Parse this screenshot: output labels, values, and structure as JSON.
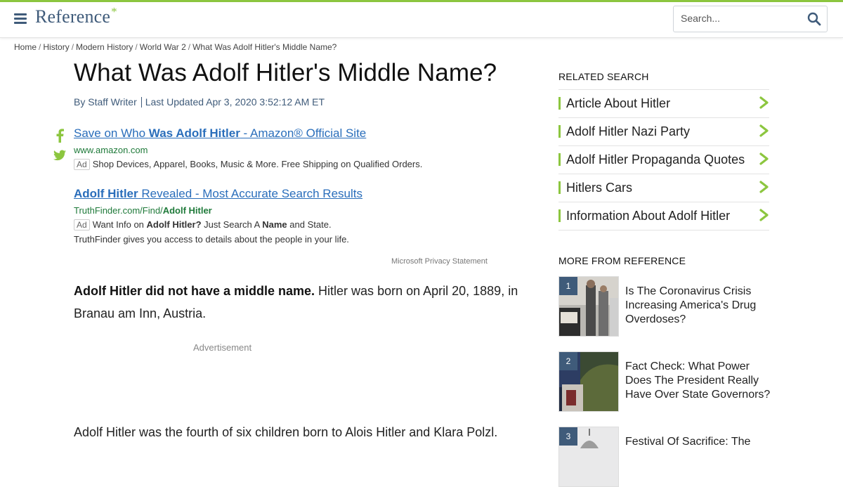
{
  "brand": {
    "name": "Reference",
    "star": "*",
    "accent": "#8cc63f",
    "primary": "#3f5b7a"
  },
  "search": {
    "placeholder": "Search..."
  },
  "breadcrumb": [
    "Home",
    "History",
    "Modern History",
    "World War 2",
    "What Was Adolf Hitler's Middle Name?"
  ],
  "article": {
    "title": "What Was Adolf Hitler's Middle Name?",
    "author": "By Staff Writer",
    "updated": "Last Updated Apr 3, 2020 3:52:12 AM ET",
    "lead_bold": "Adolf Hitler did not have a middle name.",
    "lead_rest": " Hitler was born on April 20, 1889, in Branau am Inn, Austria.",
    "advertisement_label": "Advertisement",
    "paragraph2": "Adolf Hitler was the fourth of six children born to Alois Hitler and Klara Polzl."
  },
  "share": {
    "icons": [
      "facebook-icon",
      "twitter-icon"
    ]
  },
  "ads": [
    {
      "title_pre": "Save on Who ",
      "title_bold": "Was Adolf Hitler",
      "title_post": " - Amazon® Official Site",
      "url_pre": "www.amazon.com",
      "url_bold": "",
      "badge": "Ad",
      "desc": "Shop Devices, Apparel, Books, Music & More. Free Shipping on Qualified Orders."
    },
    {
      "title_pre": "",
      "title_bold": "Adolf Hitler",
      "title_post": " Revealed - Most Accurate Search Results",
      "url_pre": "TruthFinder.com/Find/",
      "url_bold": "Adolf Hitler",
      "badge": "Ad",
      "desc_1": "Want Info on ",
      "desc_2": "Adolf Hitler?",
      "desc_3": " Just Search A ",
      "desc_4": "Name",
      "desc_5": " and State.",
      "desc_line2": "TruthFinder gives you access to details about the people in your life."
    }
  ],
  "privacy_label": "Microsoft Privacy Statement",
  "related": {
    "heading": "RELATED SEARCH",
    "items": [
      {
        "label": "Article About Hitler"
      },
      {
        "label": "Adolf Hitler Nazi Party"
      },
      {
        "label": "Adolf Hitler Propaganda Quotes"
      },
      {
        "label": "Hitlers Cars"
      },
      {
        "label": "Information About Adolf Hitler"
      }
    ]
  },
  "more": {
    "heading": "MORE FROM REFERENCE",
    "items": [
      {
        "num": "1",
        "title": "Is The Coronavirus Crisis Increasing America's Drug Overdoses?"
      },
      {
        "num": "2",
        "title": "Fact Check: What Power Does The President Really Have Over State Governors?"
      },
      {
        "num": "3",
        "title": "Festival Of Sacrifice: The"
      }
    ]
  }
}
